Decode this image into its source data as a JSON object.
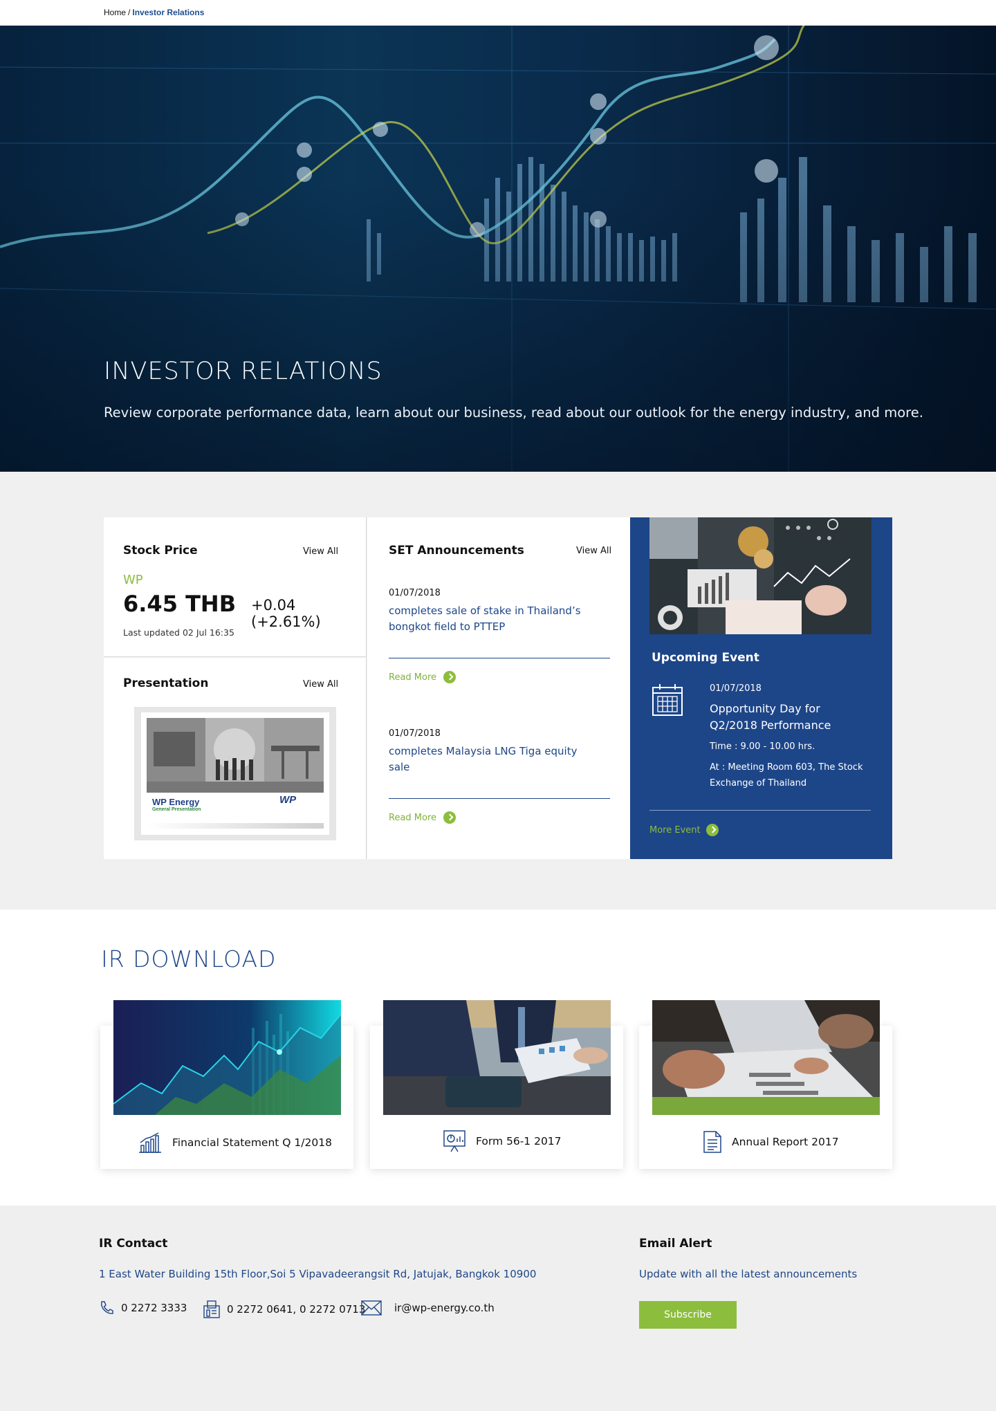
{
  "breadcrumb": {
    "home": "Home",
    "separator": "/",
    "current": "Investor Relations"
  },
  "hero": {
    "title": "INVESTOR RELATIONS",
    "subtitle": "Review corporate performance data, learn about our business, read about our outlook for the energy industry, and more."
  },
  "stock": {
    "title": "Stock Price",
    "view_all": "View All",
    "ticker": "WP",
    "price": "6.45 THB",
    "change": "+0.04 (+2.61%)",
    "updated": "Last updated 02 Jul 16:35"
  },
  "presentation": {
    "title": "Presentation",
    "view_all": "View All",
    "doc_title": "WP Energy",
    "doc_subtitle": "General Presentation",
    "logo_text": "WP"
  },
  "announcements": {
    "title": "SET Announcements",
    "view_all": "View All",
    "items": [
      {
        "date": "01/07/2018",
        "text": "completes sale of stake in Thailand’s bongkot field to PTTEP",
        "read_more": "Read More"
      },
      {
        "date": "01/07/2018",
        "text": "completes Malaysia LNG Tiga equity sale",
        "read_more": "Read More"
      }
    ]
  },
  "event": {
    "title": "Upcoming Event",
    "date": "01/07/2018",
    "name": "Opportunity Day for Q2/2018 Performance",
    "time": "Time : 9.00 - 10.00 hrs.",
    "location": "At : Meeting Room 603, The Stock Exchange of Thailand",
    "more": "More Event"
  },
  "downloads": {
    "title": "IR DOWNLOAD",
    "items": [
      {
        "label": "Financial Statement Q 1/2018",
        "icon": "bar-chart-icon"
      },
      {
        "label": "Form 56-1 2017",
        "icon": "presentation-board-icon"
      },
      {
        "label": "Annual Report 2017",
        "icon": "document-icon"
      }
    ]
  },
  "contact": {
    "title": "IR Contact",
    "address": "1 East Water Building 15th Floor,Soi 5 Vipavadeerangsit Rd, Jatujak, Bangkok 10900",
    "phone": "0 2272 3333",
    "fax": "0 2272 0641, 0 2272 0713",
    "email": "ir@wp-energy.co.th"
  },
  "email_alert": {
    "title": "Email Alert",
    "text": "Update with all the latest announcements",
    "button": "Subscribe"
  },
  "colors": {
    "brand_blue": "#1d4688",
    "accent_green": "#8dbd3d",
    "band_gray": "#f0f0f0"
  }
}
